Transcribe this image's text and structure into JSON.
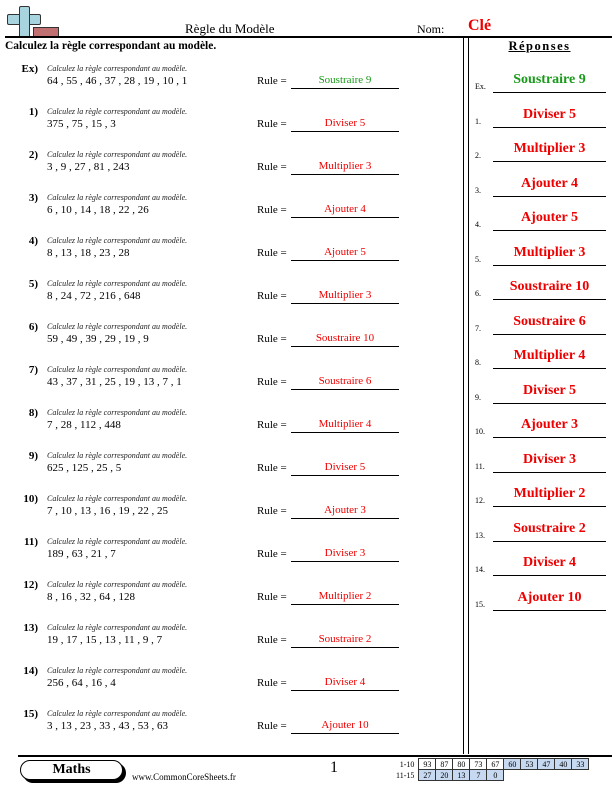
{
  "header": {
    "logo_icon": "plus-minus-icon",
    "title": "Règle du Modèle",
    "name_label": "Nom:",
    "name_value": "Clé",
    "instructions": "Calculez la règle correspondant au modèle."
  },
  "colors": {
    "answer_red": "#ee0000",
    "example_green": "#1a9a1a",
    "score_blue": "#c6d9f1"
  },
  "problems": [
    {
      "num": "Ex)",
      "instruction": "Calculez la règle correspondant au modèle.",
      "sequence": "64 , 55 , 46 , 37 , 28 , 19 , 10 , 1",
      "rule_label": "Rule =",
      "answer": "Soustraire 9"
    },
    {
      "num": "1)",
      "instruction": "Calculez la règle correspondant au modèle.",
      "sequence": "375 , 75 , 15 , 3",
      "rule_label": "Rule =",
      "answer": "Diviser 5"
    },
    {
      "num": "2)",
      "instruction": "Calculez la règle correspondant au modèle.",
      "sequence": "3 , 9 , 27 , 81 , 243",
      "rule_label": "Rule =",
      "answer": "Multiplier 3"
    },
    {
      "num": "3)",
      "instruction": "Calculez la règle correspondant au modèle.",
      "sequence": "6 , 10 , 14 , 18 , 22 , 26",
      "rule_label": "Rule =",
      "answer": "Ajouter 4"
    },
    {
      "num": "4)",
      "instruction": "Calculez la règle correspondant au modèle.",
      "sequence": "8 , 13 , 18 , 23 , 28",
      "rule_label": "Rule =",
      "answer": "Ajouter 5"
    },
    {
      "num": "5)",
      "instruction": "Calculez la règle correspondant au modèle.",
      "sequence": "8 , 24 , 72 , 216 , 648",
      "rule_label": "Rule =",
      "answer": "Multiplier 3"
    },
    {
      "num": "6)",
      "instruction": "Calculez la règle correspondant au modèle.",
      "sequence": "59 , 49 , 39 , 29 , 19 , 9",
      "rule_label": "Rule =",
      "answer": "Soustraire 10"
    },
    {
      "num": "7)",
      "instruction": "Calculez la règle correspondant au modèle.",
      "sequence": "43 , 37 , 31 , 25 , 19 , 13 , 7 , 1",
      "rule_label": "Rule =",
      "answer": "Soustraire 6"
    },
    {
      "num": "8)",
      "instruction": "Calculez la règle correspondant au modèle.",
      "sequence": "7 , 28 , 112 , 448",
      "rule_label": "Rule =",
      "answer": "Multiplier 4"
    },
    {
      "num": "9)",
      "instruction": "Calculez la règle correspondant au modèle.",
      "sequence": "625 , 125 , 25 , 5",
      "rule_label": "Rule =",
      "answer": "Diviser 5"
    },
    {
      "num": "10)",
      "instruction": "Calculez la règle correspondant au modèle.",
      "sequence": "7 , 10 , 13 , 16 , 19 , 22 , 25",
      "rule_label": "Rule =",
      "answer": "Ajouter 3"
    },
    {
      "num": "11)",
      "instruction": "Calculez la règle correspondant au modèle.",
      "sequence": "189 , 63 , 21 , 7",
      "rule_label": "Rule =",
      "answer": "Diviser 3"
    },
    {
      "num": "12)",
      "instruction": "Calculez la règle correspondant au modèle.",
      "sequence": "8 , 16 , 32 , 64 , 128",
      "rule_label": "Rule =",
      "answer": "Multiplier 2"
    },
    {
      "num": "13)",
      "instruction": "Calculez la règle correspondant au modèle.",
      "sequence": "19 , 17 , 15 , 13 , 11 , 9 , 7",
      "rule_label": "Rule =",
      "answer": "Soustraire 2"
    },
    {
      "num": "14)",
      "instruction": "Calculez la règle correspondant au modèle.",
      "sequence": "256 , 64 , 16 , 4",
      "rule_label": "Rule =",
      "answer": "Diviser 4"
    },
    {
      "num": "15)",
      "instruction": "Calculez la règle correspondant au modèle.",
      "sequence": "3 , 13 , 23 , 33 , 43 , 53 , 63",
      "rule_label": "Rule =",
      "answer": "Ajouter 10"
    }
  ],
  "answers": {
    "title": "Réponses",
    "items": [
      {
        "num": "Ex.",
        "answer": "Soustraire 9"
      },
      {
        "num": "1.",
        "answer": "Diviser 5"
      },
      {
        "num": "2.",
        "answer": "Multiplier 3"
      },
      {
        "num": "3.",
        "answer": "Ajouter 4"
      },
      {
        "num": "4.",
        "answer": "Ajouter 5"
      },
      {
        "num": "5.",
        "answer": "Multiplier 3"
      },
      {
        "num": "6.",
        "answer": "Soustraire 10"
      },
      {
        "num": "7.",
        "answer": "Soustraire 6"
      },
      {
        "num": "8.",
        "answer": "Multiplier 4"
      },
      {
        "num": "9.",
        "answer": "Diviser 5"
      },
      {
        "num": "10.",
        "answer": "Ajouter 3"
      },
      {
        "num": "11.",
        "answer": "Diviser 3"
      },
      {
        "num": "12.",
        "answer": "Multiplier 2"
      },
      {
        "num": "13.",
        "answer": "Soustraire 2"
      },
      {
        "num": "14.",
        "answer": "Diviser 4"
      },
      {
        "num": "15.",
        "answer": "Ajouter 10"
      }
    ]
  },
  "footer": {
    "subject": "Maths",
    "website": "www.CommonCoreSheets.fr",
    "page_number": "1",
    "score_rows": [
      {
        "label": "1-10",
        "scores": [
          "93",
          "87",
          "80",
          "73",
          "67",
          "60",
          "53",
          "47",
          "40",
          "33"
        ]
      },
      {
        "label": "11-15",
        "scores": [
          "27",
          "20",
          "13",
          "7",
          "0"
        ]
      }
    ]
  }
}
